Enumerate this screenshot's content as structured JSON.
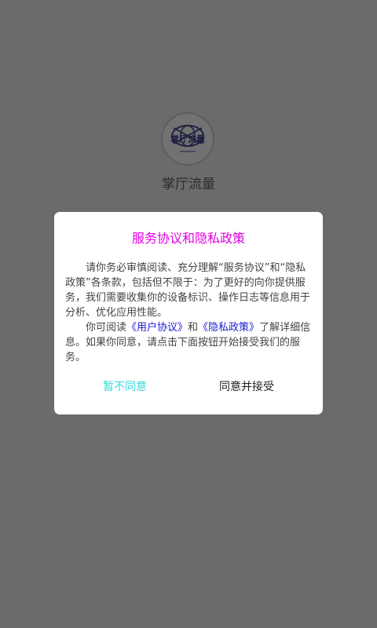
{
  "app": {
    "logo_text": "掌厅流量",
    "name": "掌厅流量"
  },
  "dialog": {
    "title": "服务协议和隐私政策",
    "paragraph1": "请你务必审慎阅读、充分理解“服务协议”和“隐私政策”各条款，包括但不限于：为了更好的向你提供服务，我们需要收集你的设备标识、操作日志等信息用于分析、优化应用性能。",
    "p2_prefix": "你可阅读",
    "link_user_agreement": "《用户协议》",
    "p2_and": "和",
    "link_privacy_policy": "《隐私政策》",
    "p2_suffix": "了解详细信息。如果你同意，请点击下面按钮开始接受我们的服务。",
    "decline_label": "暂不同意",
    "accept_label": "同意并接受"
  },
  "colors": {
    "overlay": "#6b6b6b",
    "title": "#e200e2",
    "link": "#1b1bd0",
    "decline": "#37d7de"
  }
}
